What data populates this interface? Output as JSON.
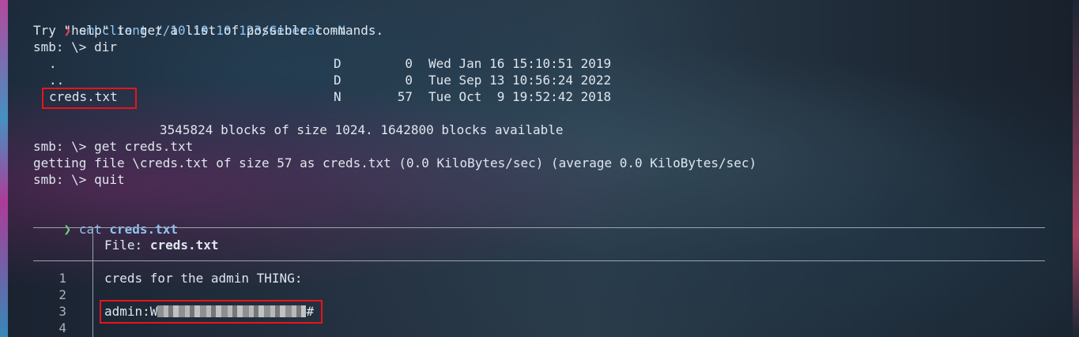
{
  "terminal": {
    "line1": {
      "prompt": "❯",
      "command": "smbclient //10.10.10.123/General -N"
    },
    "line2": "Try \"help\" to get a list of possible commands.",
    "line3": "smb: \\> dir",
    "dir_entries": [
      {
        "name": ".",
        "type": "D",
        "size": "0",
        "date": "Wed Jan 16 15:10:51 2019"
      },
      {
        "name": "..",
        "type": "D",
        "size": "0",
        "date": "Tue Sep 13 10:56:24 2022"
      },
      {
        "name": "creds.txt",
        "type": "N",
        "size": "57",
        "date": "Tue Oct  9 19:52:42 2018"
      }
    ],
    "blocks_info": "3545824 blocks of size 1024. 1642800 blocks available",
    "get_cmd": "smb: \\> get creds.txt",
    "get_result": "getting file \\creds.txt of size 57 as creds.txt (0.0 KiloBytes/sec) (average 0.0 KiloBytes/sec)",
    "quit_cmd": "smb: \\> quit",
    "cat_line": {
      "prompt": "❯",
      "command": "cat",
      "arg": "creds.txt"
    }
  },
  "bat": {
    "file_label": "File:",
    "file_name": "creds.txt",
    "lines": [
      {
        "num": "1",
        "text": "creds for the admin THING:"
      },
      {
        "num": "2",
        "text": ""
      },
      {
        "num": "3",
        "prefix": "admin:W",
        "suffix": "#"
      },
      {
        "num": "4",
        "text": ""
      }
    ]
  },
  "colors": {
    "highlight": "#e8141c",
    "prompt_red": "#e0405a",
    "prompt_green": "#6fd37a",
    "command": "#8fc6f2"
  }
}
